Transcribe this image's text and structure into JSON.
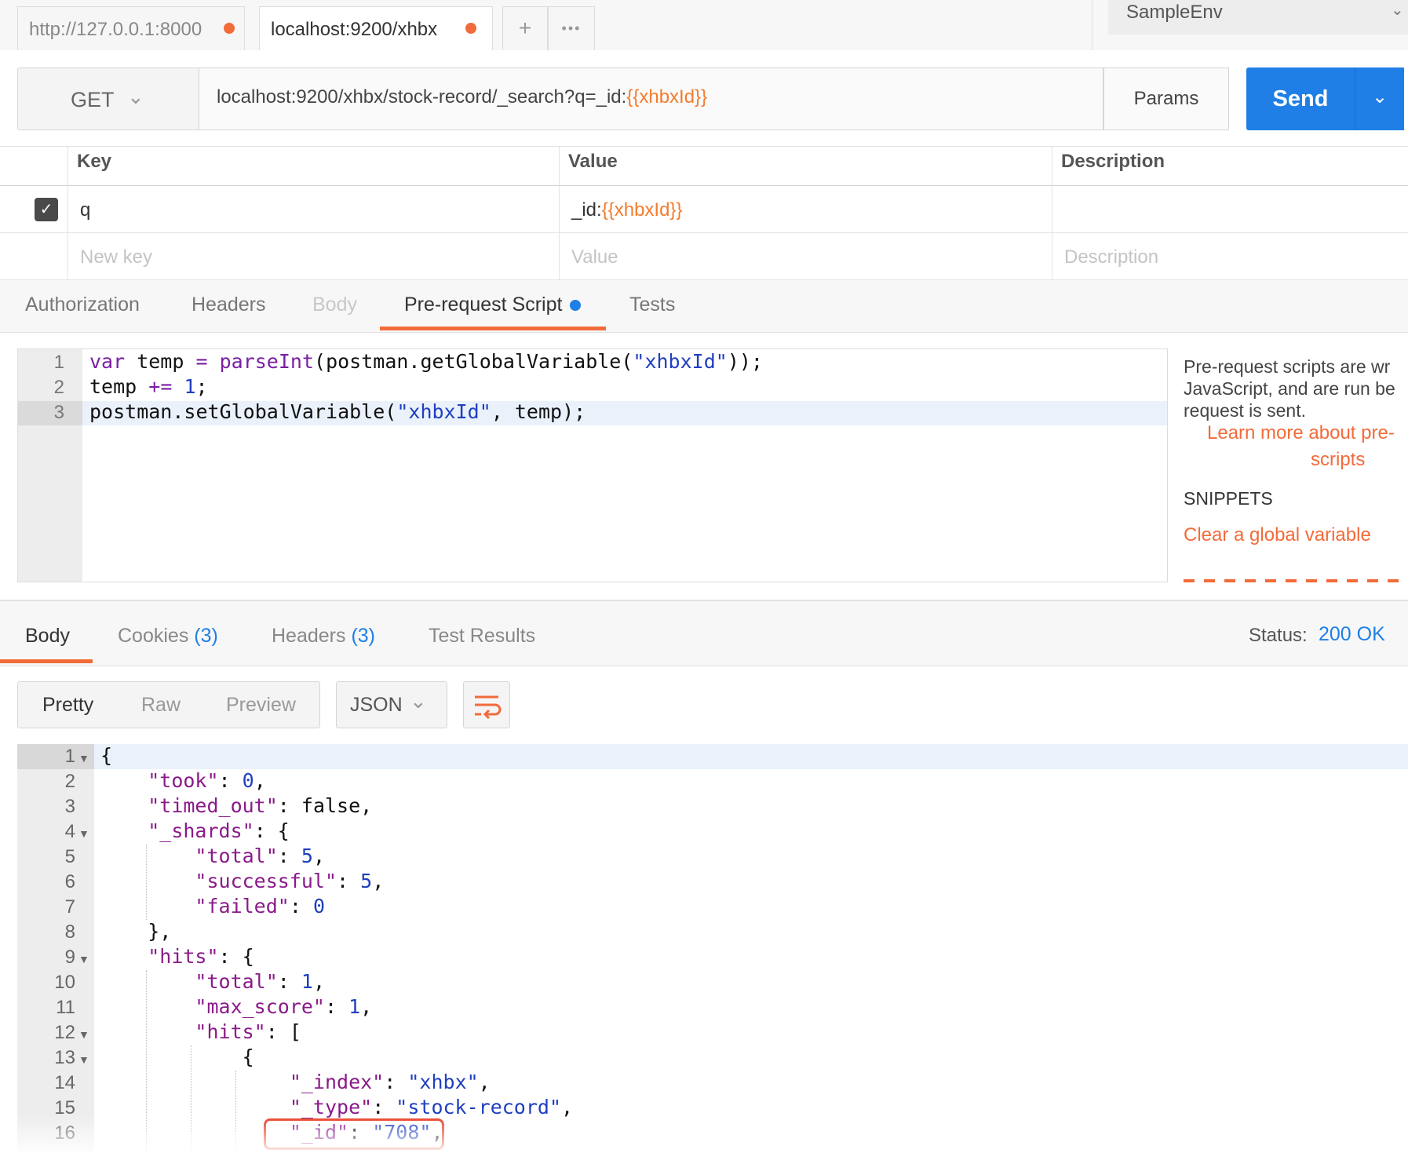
{
  "tabs": [
    {
      "label": "http://127.0.0.1:8000",
      "active": false
    },
    {
      "label": "localhost:9200/xhbx",
      "active": true
    }
  ],
  "tab_tools": {
    "add": "+",
    "more": "•••"
  },
  "environment": {
    "label": "SampleEnv"
  },
  "request": {
    "method": "GET",
    "url_prefix": "localhost:9200/xhbx/stock-record/_search?q=_id:",
    "url_var": "{{xhbxId}}",
    "params_label": "Params",
    "send_label": "Send"
  },
  "params_table": {
    "headers": [
      "Key",
      "Value",
      "Description"
    ],
    "row": {
      "key": "q",
      "value_prefix": "_id:",
      "value_var": "{{xhbxId}}"
    },
    "placeholders": {
      "key": "New key",
      "value": "Value",
      "description": "Description"
    }
  },
  "request_tabs": [
    "Authorization",
    "Headers",
    "Body",
    "Pre-request Script",
    "Tests"
  ],
  "script": {
    "lines": [
      "1",
      "2",
      "3"
    ]
  },
  "side_help": {
    "line1": "Pre-request scripts are wr",
    "line2": "JavaScript, and are run be",
    "line3": "request is sent.",
    "link1": "Learn more about pre-",
    "link2": "scripts",
    "snippets_title": "SNIPPETS",
    "snippet1": "Clear a global variable"
  },
  "response_tabs": {
    "body": "Body",
    "cookies": "Cookies",
    "cookies_count": "(3)",
    "headers": "Headers",
    "headers_count": "(3)",
    "tests": "Test Results"
  },
  "status": {
    "label": "Status:",
    "value": "200 OK"
  },
  "view_modes": [
    "Pretty",
    "Raw",
    "Preview"
  ],
  "format": "JSON",
  "json_line_numbers": [
    "1",
    "2",
    "3",
    "4",
    "5",
    "6",
    "7",
    "8",
    "9",
    "10",
    "11",
    "12",
    "13",
    "14",
    "15",
    "16"
  ]
}
